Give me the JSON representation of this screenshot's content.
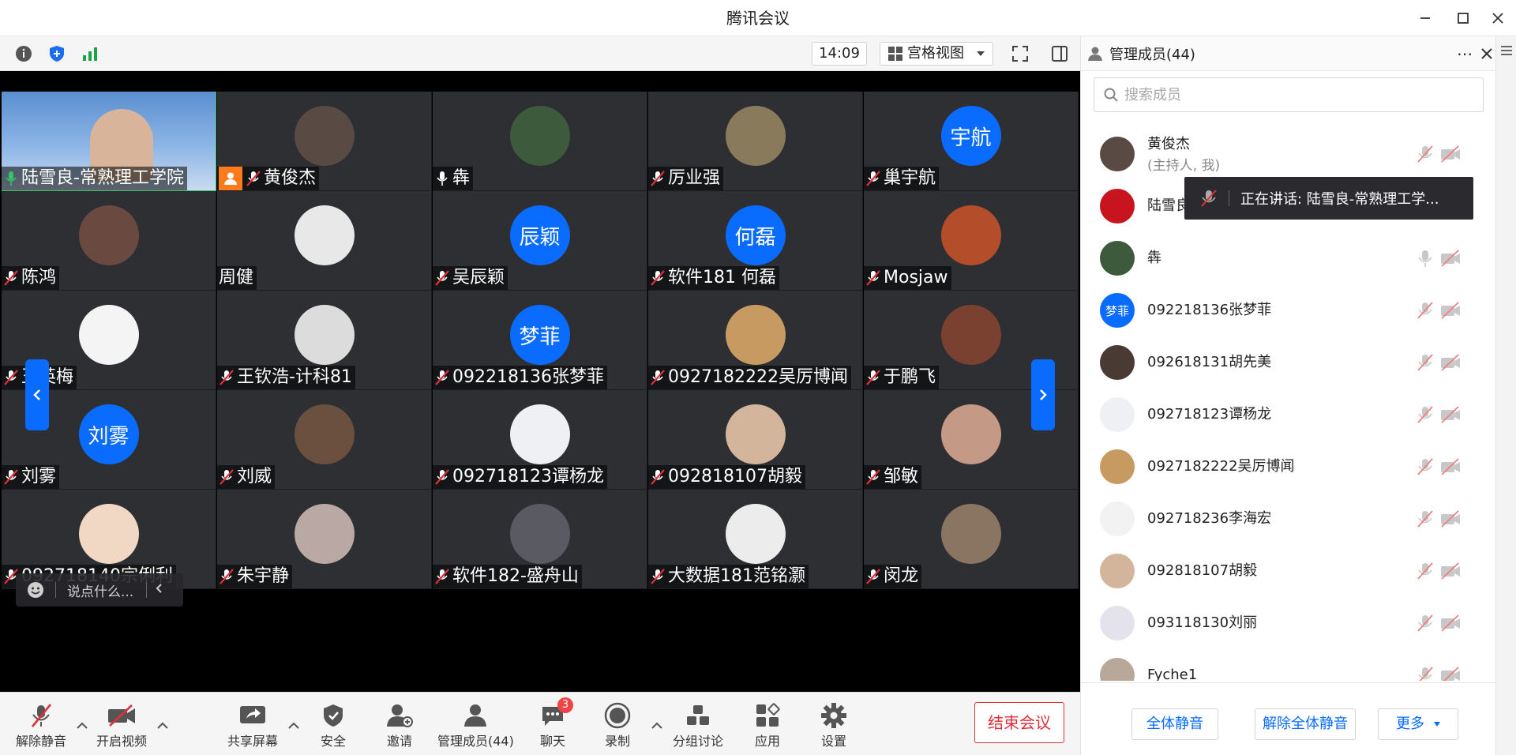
{
  "window": {
    "title": "腾讯会议"
  },
  "toolbar": {
    "time": "14:09",
    "view_label": "宫格视图"
  },
  "tiles": [
    {
      "name": "陆雪良-常熟理工学院",
      "mic": "on",
      "avatar": "photo",
      "color": "#6b8fb8"
    },
    {
      "name": "黄俊杰",
      "mic": "muted",
      "avatar": "photo",
      "color": "#5a4a44",
      "host": true
    },
    {
      "name": "犇",
      "mic": "on",
      "avatar": "photo",
      "color": "#3e5a3c"
    },
    {
      "name": "厉业强",
      "mic": "muted",
      "avatar": "photo",
      "color": "#8a7a5c"
    },
    {
      "name": "巢宇航",
      "mic": "muted",
      "avatar": "text",
      "initials": "宇航"
    },
    {
      "name": "陈鸿",
      "mic": "muted",
      "avatar": "photo",
      "color": "#6a4a40"
    },
    {
      "name": "周健",
      "mic": "none",
      "avatar": "photo",
      "color": "#e8e8e8"
    },
    {
      "name": "吴辰颖",
      "mic": "muted",
      "avatar": "text",
      "initials": "辰颖"
    },
    {
      "name": "软件181 何磊",
      "mic": "muted",
      "avatar": "text",
      "initials": "何磊"
    },
    {
      "name": "Mosjaw",
      "mic": "muted",
      "avatar": "photo",
      "color": "#b44d2a"
    },
    {
      "name": "王英梅",
      "mic": "muted",
      "avatar": "photo",
      "color": "#f4f4f4"
    },
    {
      "name": "王钦浩-计科81",
      "mic": "muted",
      "avatar": "photo",
      "color": "#dcdcdc"
    },
    {
      "name": "092218136张梦菲",
      "mic": "muted",
      "avatar": "text",
      "initials": "梦菲"
    },
    {
      "name": "0927182222吴厉博闻",
      "mic": "muted",
      "avatar": "photo",
      "color": "#c79a62"
    },
    {
      "name": "于鹏飞",
      "mic": "muted",
      "avatar": "photo",
      "color": "#7a4030"
    },
    {
      "name": "刘雾",
      "mic": "muted",
      "avatar": "text",
      "initials": "刘雾"
    },
    {
      "name": "刘威",
      "mic": "muted",
      "avatar": "photo",
      "color": "#6b5040"
    },
    {
      "name": "092718123谭杨龙",
      "mic": "muted",
      "avatar": "photo",
      "color": "#eef0f4"
    },
    {
      "name": "092818107胡毅",
      "mic": "muted",
      "avatar": "photo",
      "color": "#d2b59a"
    },
    {
      "name": "邹敏",
      "mic": "muted",
      "avatar": "photo",
      "color": "#c49a86"
    },
    {
      "name": "092718140宗俐利",
      "mic": "muted",
      "avatar": "photo",
      "color": "#f0d8c4"
    },
    {
      "name": "朱宇静",
      "mic": "muted",
      "avatar": "photo",
      "color": "#b9a8a4"
    },
    {
      "name": "软件182-盛舟山",
      "mic": "muted",
      "avatar": "photo",
      "color": "#5a5a62"
    },
    {
      "name": "大数据181范铭灏",
      "mic": "muted",
      "avatar": "photo",
      "color": "#ececec"
    },
    {
      "name": "闵龙",
      "mic": "muted",
      "avatar": "photo",
      "color": "#8a7462"
    }
  ],
  "chat_bubble": {
    "placeholder": "说点什么..."
  },
  "bottom_bar": {
    "unmute": "解除静音",
    "start_video": "开启视频",
    "share_screen": "共享屏幕",
    "security": "安全",
    "invite": "邀请",
    "manage_members": "管理成员(44)",
    "chat": "聊天",
    "chat_badge": "3",
    "record": "录制",
    "breakout": "分组讨论",
    "apps": "应用",
    "settings": "设置",
    "end_meeting": "结束会议"
  },
  "panel": {
    "title": "管理成员(44)",
    "search_placeholder": "搜索成员",
    "speaking_tip": "正在讲话: 陆雪良-常熟理工学...",
    "members": [
      {
        "name": "黄俊杰",
        "sub": "(主持人, 我)",
        "avatar": "photo",
        "color": "#5a4a44",
        "mic": "muted"
      },
      {
        "name": "陆雪良",
        "sub": "",
        "avatar": "photo",
        "color": "#c8141e",
        "mic": "on"
      },
      {
        "name": "犇",
        "sub": "",
        "avatar": "photo",
        "color": "#3e5a3c",
        "mic": "on"
      },
      {
        "name": "092218136张梦菲",
        "sub": "",
        "avatar": "text",
        "initials": "梦菲",
        "mic": "muted"
      },
      {
        "name": "092618131胡先美",
        "sub": "",
        "avatar": "photo",
        "color": "#4a3a34",
        "mic": "muted"
      },
      {
        "name": "092718123谭杨龙",
        "sub": "",
        "avatar": "photo",
        "color": "#eef0f4",
        "mic": "muted"
      },
      {
        "name": "0927182222吴厉博闻",
        "sub": "",
        "avatar": "photo",
        "color": "#c79a62",
        "mic": "muted"
      },
      {
        "name": "092718236李海宏",
        "sub": "",
        "avatar": "photo",
        "color": "#f2f2f2",
        "mic": "muted"
      },
      {
        "name": "092818107胡毅",
        "sub": "",
        "avatar": "photo",
        "color": "#d2b59a",
        "mic": "muted"
      },
      {
        "name": "093118130刘丽",
        "sub": "",
        "avatar": "photo",
        "color": "#e4e2ec",
        "mic": "muted"
      },
      {
        "name": "Fyche1",
        "sub": "",
        "avatar": "photo",
        "color": "#b8a89a",
        "mic": "muted"
      }
    ],
    "footer": {
      "mute_all": "全体静音",
      "unmute_all": "解除全体静音",
      "more": "更多"
    }
  }
}
